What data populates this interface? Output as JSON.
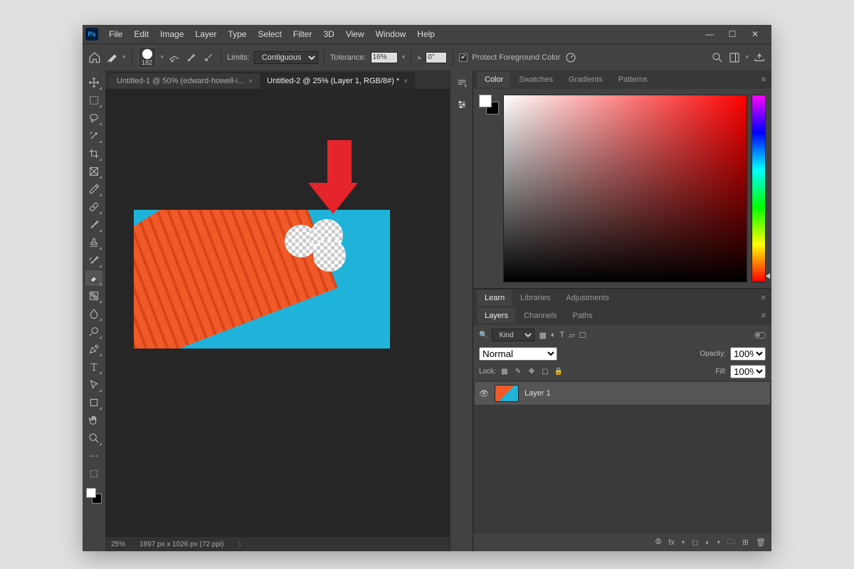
{
  "app": {
    "logo": "Ps"
  },
  "menu": {
    "file": "File",
    "edit": "Edit",
    "image": "Image",
    "layer": "Layer",
    "type": "Type",
    "select": "Select",
    "filter": "Filter",
    "threeD": "3D",
    "view": "View",
    "window": "Window",
    "help": "Help"
  },
  "options": {
    "brush_size": "182",
    "limits_label": "Limits:",
    "limits_value": "Contiguous",
    "tolerance_label": "Tolerance:",
    "tolerance_value": "16%",
    "angle_symbol": "⦛",
    "angle_value": "0°",
    "protect_fg": "Protect Foreground Color"
  },
  "tabs": {
    "tab1": "Untitled-1 @ 50% (edward-howell-i...",
    "tab2": "Untitled-2 @ 25% (Layer 1, RGB/8#) *"
  },
  "status": {
    "zoom": "25%",
    "info": "1897 px x 1026 px (72 ppi)"
  },
  "panel_tabs": {
    "color": "Color",
    "swatches": "Swatches",
    "gradients": "Gradients",
    "patterns": "Patterns",
    "learn": "Learn",
    "libraries": "Libraries",
    "adjustments": "Adjustments",
    "layers": "Layers",
    "channels": "Channels",
    "paths": "Paths"
  },
  "layers": {
    "kind_label": "Kind",
    "blend_mode": "Normal",
    "opacity_label": "Opacity:",
    "opacity_value": "100%",
    "lock_label": "Lock:",
    "fill_label": "Fill:",
    "fill_value": "100%",
    "layer1_name": "Layer 1",
    "search_icon": "🔍",
    "footer_fx": "fx"
  }
}
